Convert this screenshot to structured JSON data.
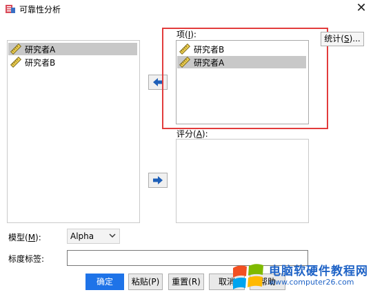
{
  "window": {
    "title": "可靠性分析",
    "close_glyph": "✕"
  },
  "source_list": {
    "items": [
      {
        "label": "研究者A",
        "selected": true
      },
      {
        "label": "研究者B",
        "selected": false
      }
    ]
  },
  "items_field": {
    "label_prefix": "项(",
    "mnemonic": "I",
    "label_suffix": "):",
    "items": [
      {
        "label": "研究者B",
        "selected": false
      },
      {
        "label": "研究者A",
        "selected": true
      }
    ]
  },
  "rater_field": {
    "label_prefix": "评分(",
    "mnemonic": "A",
    "label_suffix": "):"
  },
  "statistics_button": {
    "prefix": "统计(",
    "mnemonic": "S",
    "suffix": ")..."
  },
  "model": {
    "label_prefix": "模型(",
    "mnemonic": "M",
    "label_suffix": "):",
    "value": "Alpha"
  },
  "scale_label": {
    "label": "标度标签:",
    "value": ""
  },
  "buttons": {
    "ok": "确定",
    "paste": "粘贴(P)",
    "reset": "重置(R)",
    "cancel": "取消",
    "help": "帮助"
  },
  "watermark": {
    "title": "电脑软硬件教程网",
    "url": "www.computer26.com"
  },
  "icons": {
    "app": "reliability-app-icon",
    "variable": "ruler-icon",
    "arrow_left": "arrow-left-icon",
    "arrow_right": "arrow-right-icon",
    "dropdown": "chevron-down-icon"
  },
  "colors": {
    "primary_button": "#1e73e8",
    "highlight": "#e23b3b",
    "selection": "#c8c8c8"
  }
}
